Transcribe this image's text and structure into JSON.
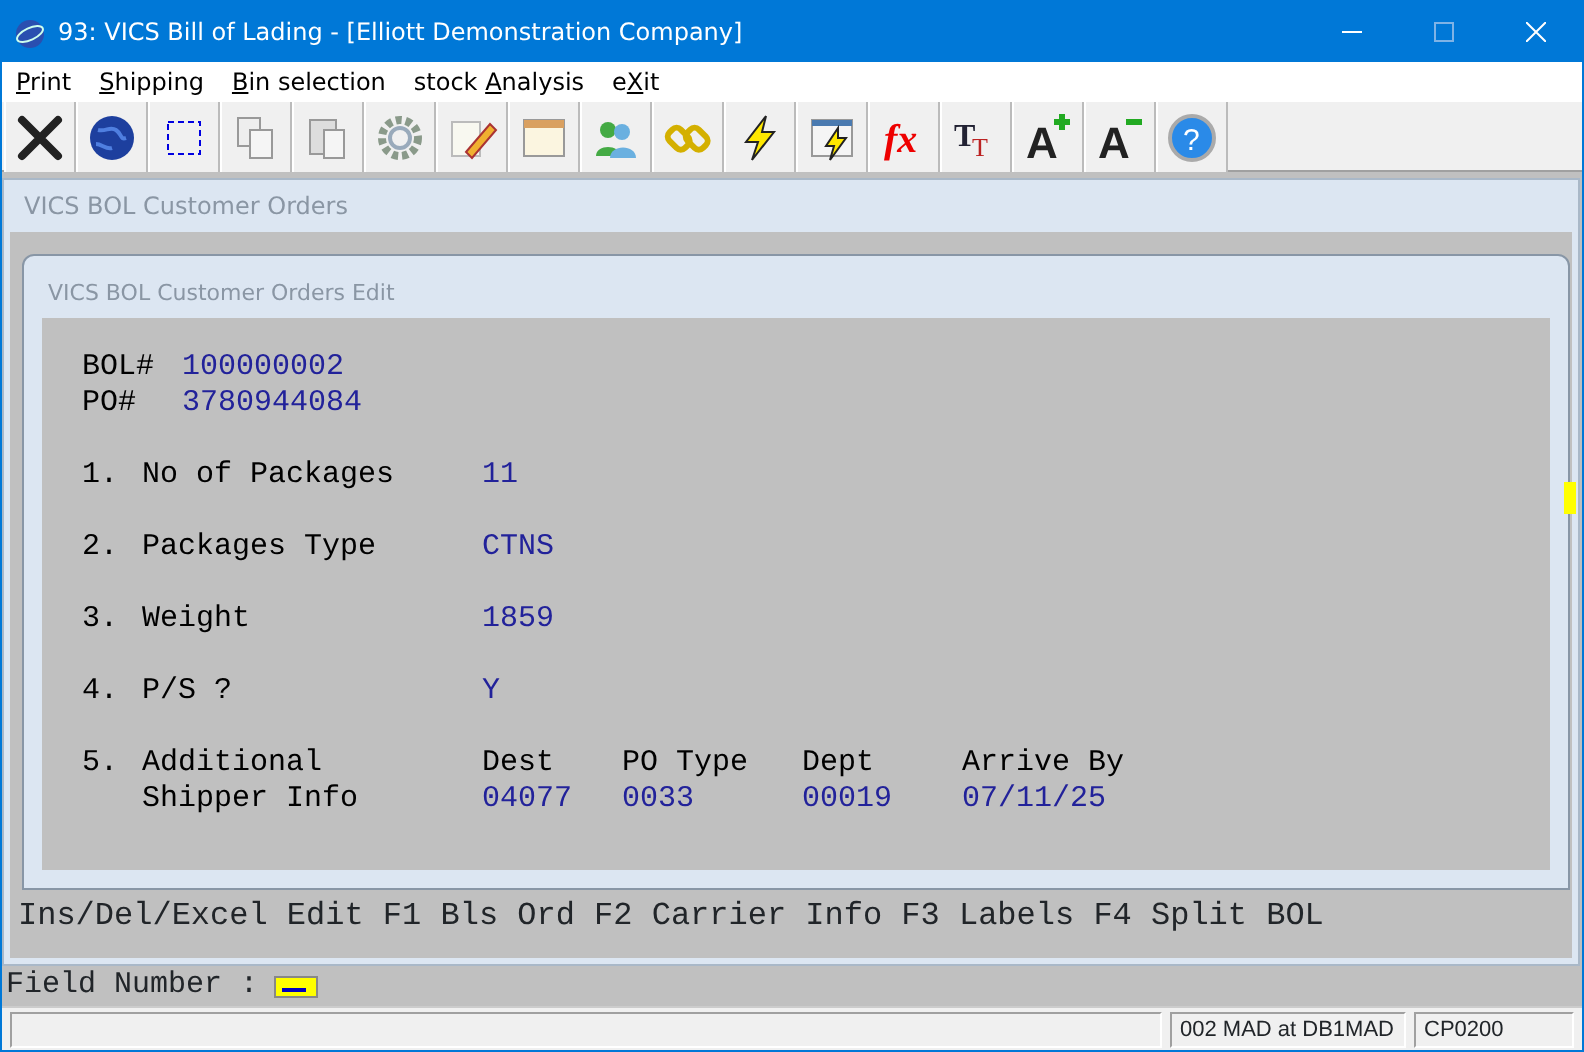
{
  "window": {
    "title": "93: VICS Bill of Lading - [Elliott Demonstration Company]"
  },
  "menu": [
    {
      "key": "P",
      "after": "rint"
    },
    {
      "key": "S",
      "after": "hipping"
    },
    {
      "key": "B",
      "after": "in selection"
    },
    {
      "before": "stock ",
      "key": "A",
      "after": "nalysis"
    },
    {
      "before": "e",
      "key": "X",
      "after": "it"
    }
  ],
  "toolbar": [
    {
      "kind": "close"
    },
    {
      "kind": "globe"
    },
    {
      "kind": "selection"
    },
    {
      "kind": "copy"
    },
    {
      "kind": "paste"
    },
    {
      "kind": "gear"
    },
    {
      "kind": "pencil"
    },
    {
      "kind": "window"
    },
    {
      "kind": "people"
    },
    {
      "kind": "chain"
    },
    {
      "kind": "lightning"
    },
    {
      "kind": "formlightning"
    },
    {
      "kind": "function",
      "glyph": "fx"
    },
    {
      "kind": "fontsize",
      "glyph": "T",
      "glyph2": "T"
    },
    {
      "kind": "larger",
      "glyph": "A"
    },
    {
      "kind": "smaller",
      "glyph": "A"
    },
    {
      "kind": "help",
      "glyph": "?"
    }
  ],
  "child_window": {
    "title": "VICS BOL Customer Orders",
    "hint_line": "Ins/Del/Excel Edit F1 Bls Ord F2 Carrier Info F3 Labels F4 Split BOL"
  },
  "dialog": {
    "title": "VICS BOL Customer Orders Edit",
    "header": [
      {
        "label": "BOL#",
        "value": "100000002"
      },
      {
        "label": "PO#",
        "value": "3780944084"
      }
    ],
    "fields": [
      {
        "number": "1.",
        "label": "No of Packages",
        "value": "11"
      },
      {
        "number": "2.",
        "label": "Packages Type",
        "value": "CTNS"
      },
      {
        "number": "3.",
        "label": "Weight",
        "value": "1859"
      },
      {
        "number": "4.",
        "label": "P/S ?",
        "value": "Y"
      }
    ],
    "additional": {
      "number": "5.",
      "label_lines": [
        "Additional",
        "Shipper Info"
      ],
      "columns": [
        {
          "heading": "Dest",
          "value": "04077"
        },
        {
          "heading": "PO Type",
          "value": "0033"
        },
        {
          "heading": "Dept",
          "value": "00019"
        },
        {
          "heading": "Arrive By",
          "value": "07/11/25"
        }
      ]
    }
  },
  "prompt": {
    "label": "Field Number :"
  },
  "status_bar": [
    "002 MAD at DB1MAD",
    "CP0200"
  ]
}
